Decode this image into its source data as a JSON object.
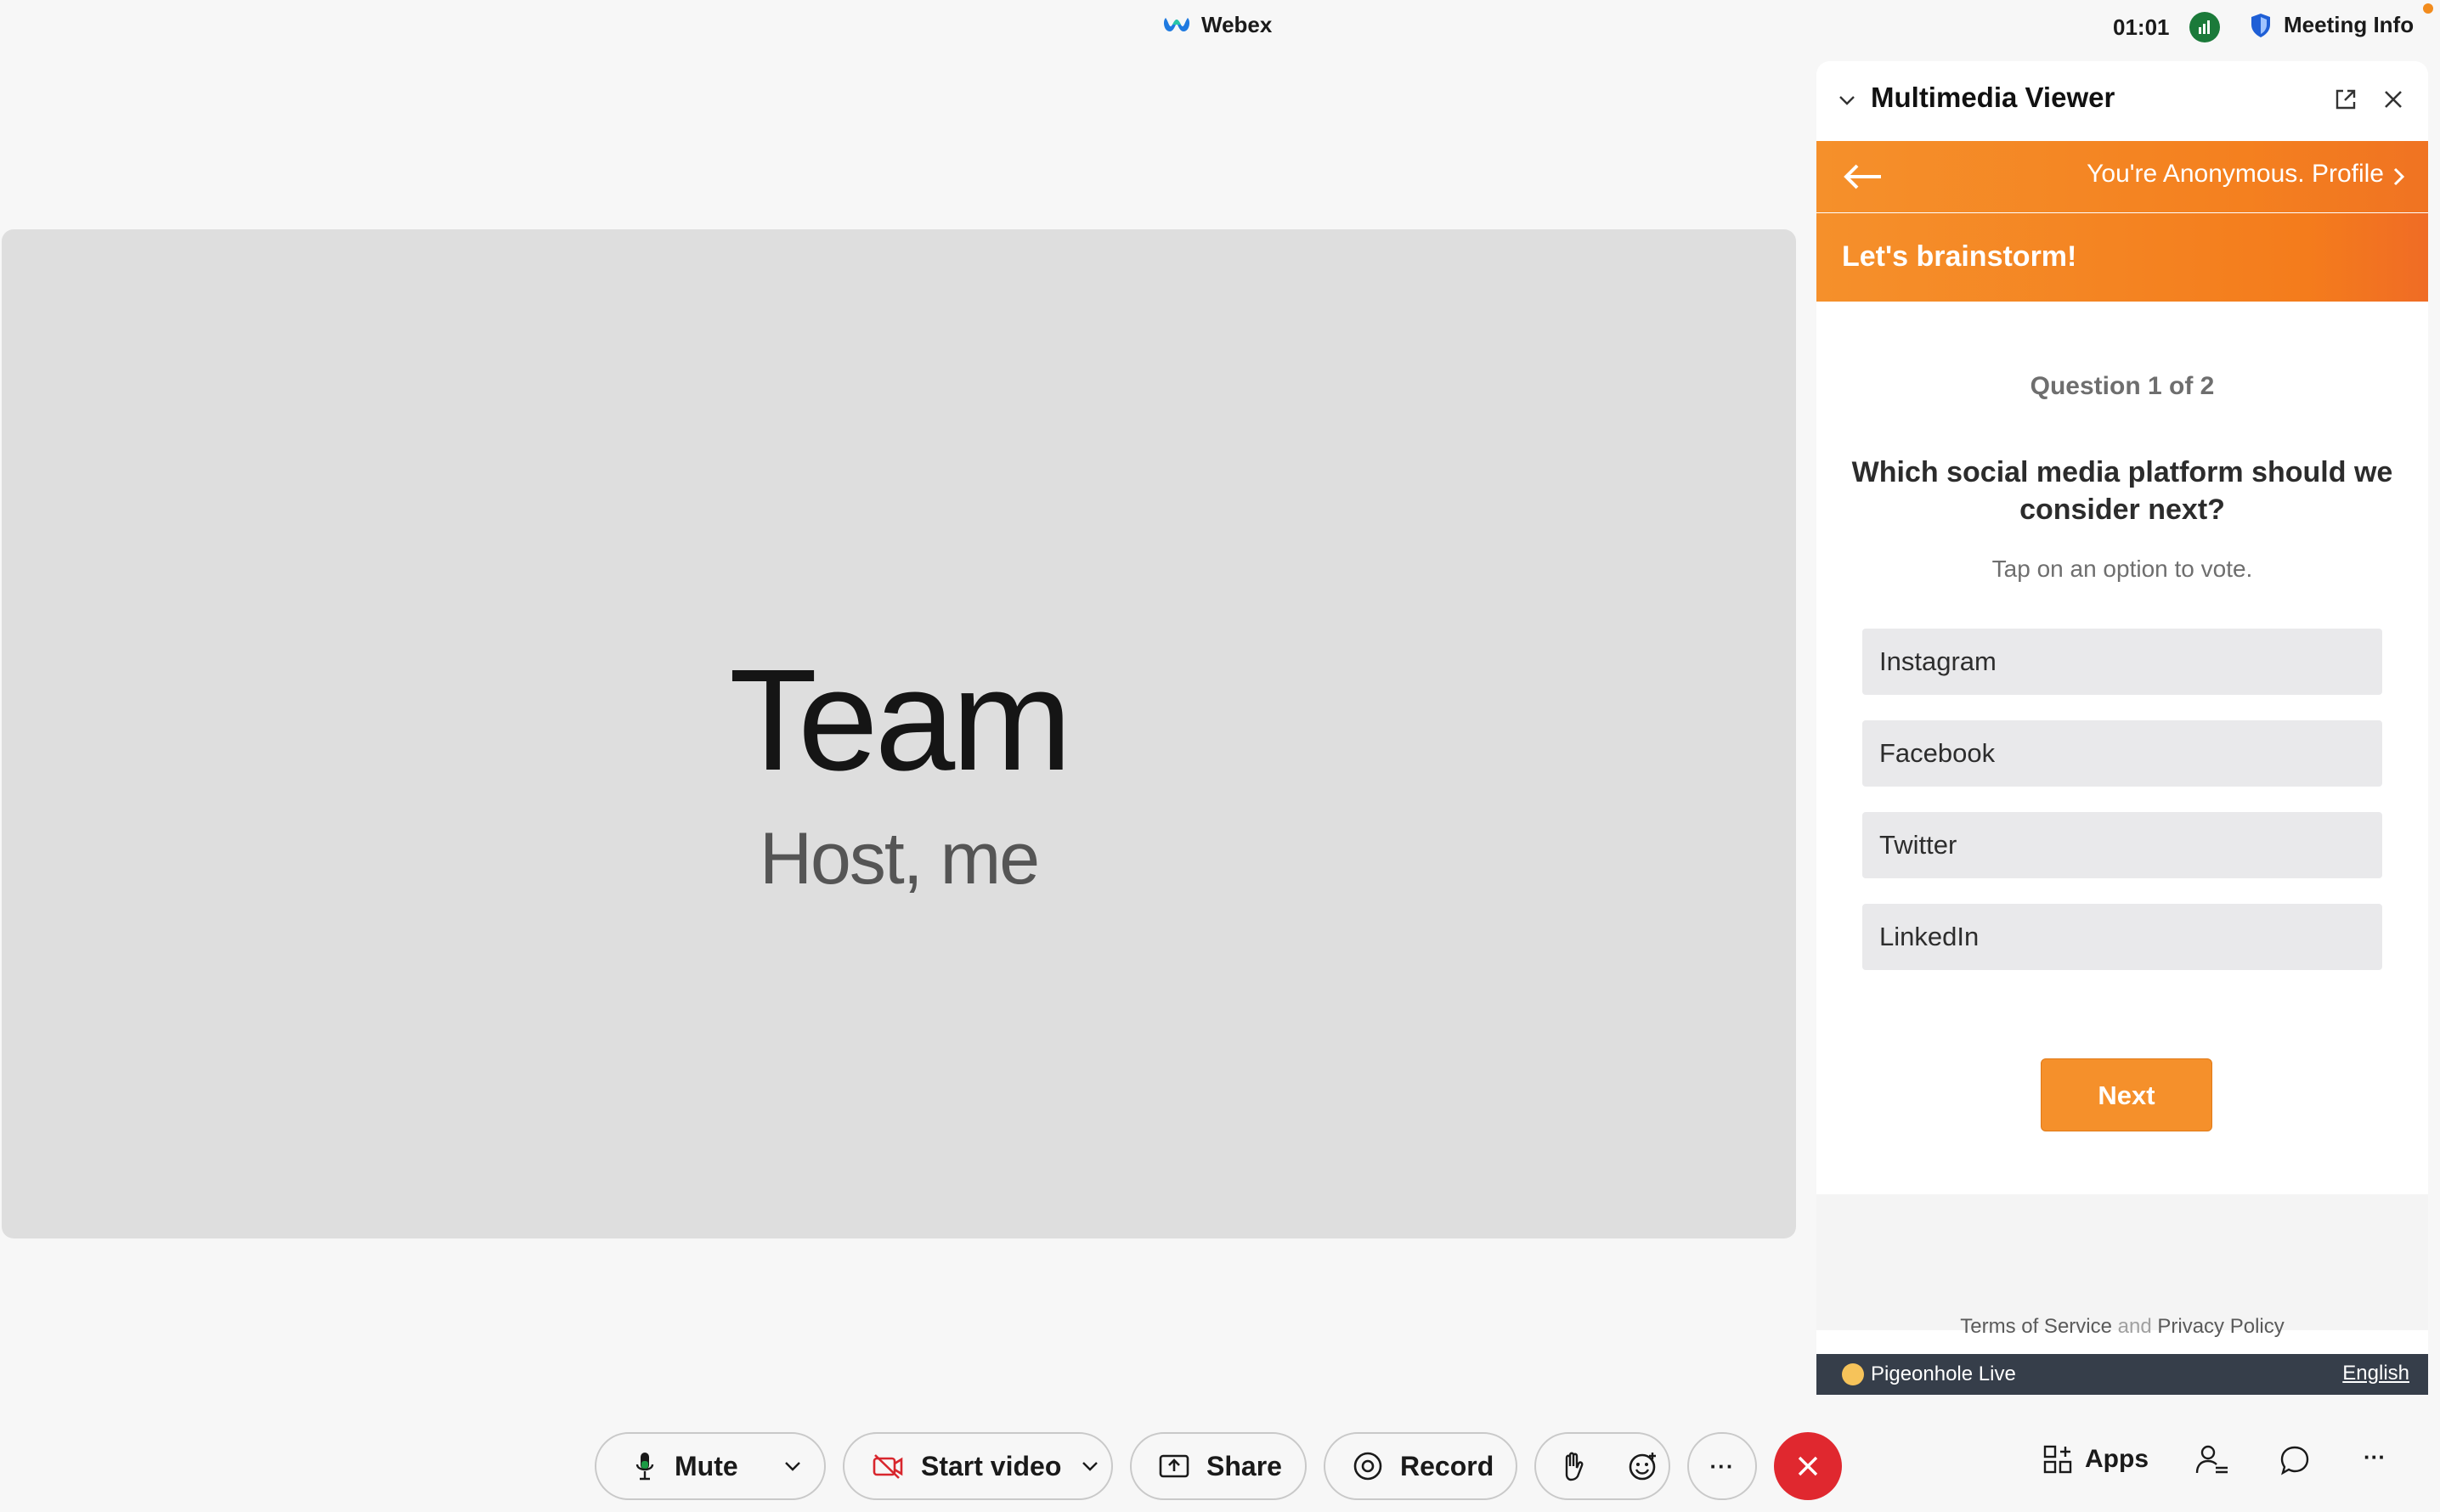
{
  "app": {
    "title": "Webex",
    "clock": "01:01",
    "meeting_info": "Meeting Info"
  },
  "stage": {
    "name": "Team",
    "role": "Host, me"
  },
  "panel": {
    "title": "Multimedia Viewer",
    "profile_link": "You're Anonymous. Profile",
    "session_title": "Let's brainstorm!",
    "question_count": "Question 1 of 2",
    "question": "Which social media platform should we consider next?",
    "hint": "Tap on an option to vote.",
    "options": [
      "Instagram",
      "Facebook",
      "Twitter",
      "LinkedIn"
    ],
    "next_label": "Next",
    "terms": "Terms of Service",
    "and": "and",
    "privacy": "Privacy Policy",
    "brand": "Pigeonhole Live",
    "language": "English"
  },
  "toolbar": {
    "mute": "Mute",
    "start_video": "Start video",
    "share": "Share",
    "record": "Record",
    "more": "···",
    "apps": "Apps",
    "overflow": "···"
  },
  "colors": {
    "accent": "#f5902b",
    "end_call": "#e0282f",
    "footer": "#363e4a"
  }
}
